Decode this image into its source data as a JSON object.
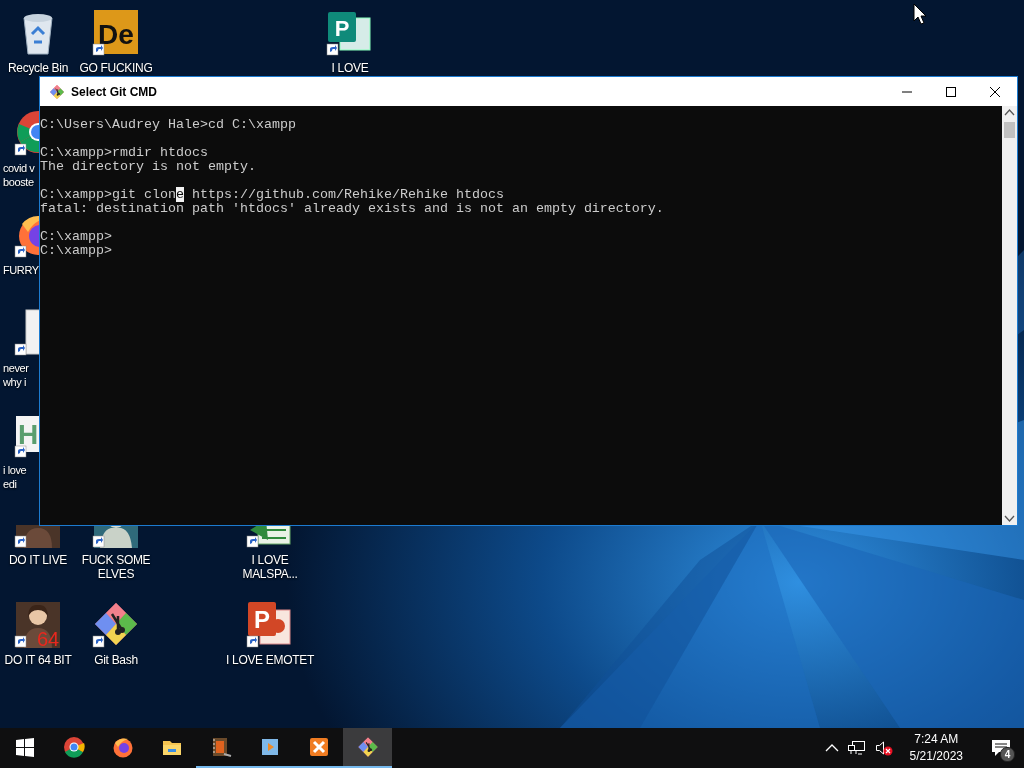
{
  "desktop": {
    "icons": [
      {
        "kind": "recycle",
        "label": [
          "Recycle Bin"
        ],
        "shortcut": false
      },
      {
        "kind": "tile",
        "glyph": "De",
        "label": [
          "GO FUCKING"
        ],
        "shortcut": true
      },
      {
        "kind": "publisher",
        "glyph": "P",
        "label": [
          "I LOVE"
        ],
        "shortcut": true
      },
      {
        "kind": "chrome",
        "label": [
          "covid v",
          "booste"
        ],
        "shortcut": true
      },
      {
        "kind": "firefox",
        "label": [
          "FURRY"
        ],
        "shortcut": true
      },
      {
        "kind": "document",
        "label": [
          "never",
          "why i"
        ],
        "shortcut": true
      },
      {
        "kind": "hx",
        "glyph": "H",
        "label": [
          "i love",
          "edi"
        ],
        "shortcut": true
      },
      {
        "kind": "portrait",
        "label": [
          "DO IT LIVE"
        ],
        "shortcut": true
      },
      {
        "kind": "figure",
        "label": [
          "FUCK SOME",
          "ELVES"
        ],
        "shortcut": true
      },
      {
        "kind": "spreadsheet",
        "label": [
          "I LOVE",
          "MALSPA..."
        ],
        "shortcut": true
      },
      {
        "kind": "portrait",
        "overlay": "64",
        "label": [
          "DO IT 64 BIT"
        ],
        "shortcut": true
      },
      {
        "kind": "gitbash",
        "label": [
          "Git Bash"
        ],
        "shortcut": true
      },
      {
        "kind": "slides",
        "glyph": "P",
        "label": [
          "I LOVE EMOTET"
        ],
        "shortcut": true
      }
    ]
  },
  "window": {
    "title": "Select Git CMD",
    "controls": [
      {
        "kind": "minimize"
      },
      {
        "kind": "maximize"
      },
      {
        "kind": "close"
      }
    ],
    "blocks": [
      {
        "lines": [
          {
            "text": "C:\\Users\\Audrey Hale>cd C:\\xampp"
          }
        ]
      },
      {
        "lines": [
          {
            "text": "C:\\xampp>rmdir htdocs"
          },
          {
            "text": "The directory is not empty."
          }
        ]
      },
      {
        "lines": [
          {
            "text": "C:\\xampp>git clon",
            "selected_text": "e",
            "text_after": " https://github.com/Rehike/Rehike htdocs"
          },
          {
            "text": "fatal: destination path 'htdocs' already exists and is not an empty directory."
          }
        ]
      },
      {
        "lines": [
          {
            "text": "C:\\xampp>"
          },
          {
            "text": "C:\\xampp>"
          }
        ]
      }
    ]
  },
  "taskbar": {
    "items": [
      {
        "kind": "start",
        "running": false,
        "selected": false
      },
      {
        "kind": "chrome",
        "running": false,
        "selected": false
      },
      {
        "kind": "firefox",
        "running": false,
        "selected": false
      },
      {
        "kind": "explorer",
        "running": false,
        "selected": false
      },
      {
        "kind": "filmstrip",
        "running": true,
        "selected": false
      },
      {
        "kind": "media",
        "running": true,
        "selected": false
      },
      {
        "kind": "xampp",
        "running": true,
        "selected": false
      },
      {
        "kind": "gitbash",
        "running": true,
        "selected": true
      }
    ],
    "volume": {
      "muted": true
    },
    "clock": {
      "time": "7:24 AM",
      "date": "5/21/2023"
    },
    "notifications": {
      "count": "4"
    }
  }
}
